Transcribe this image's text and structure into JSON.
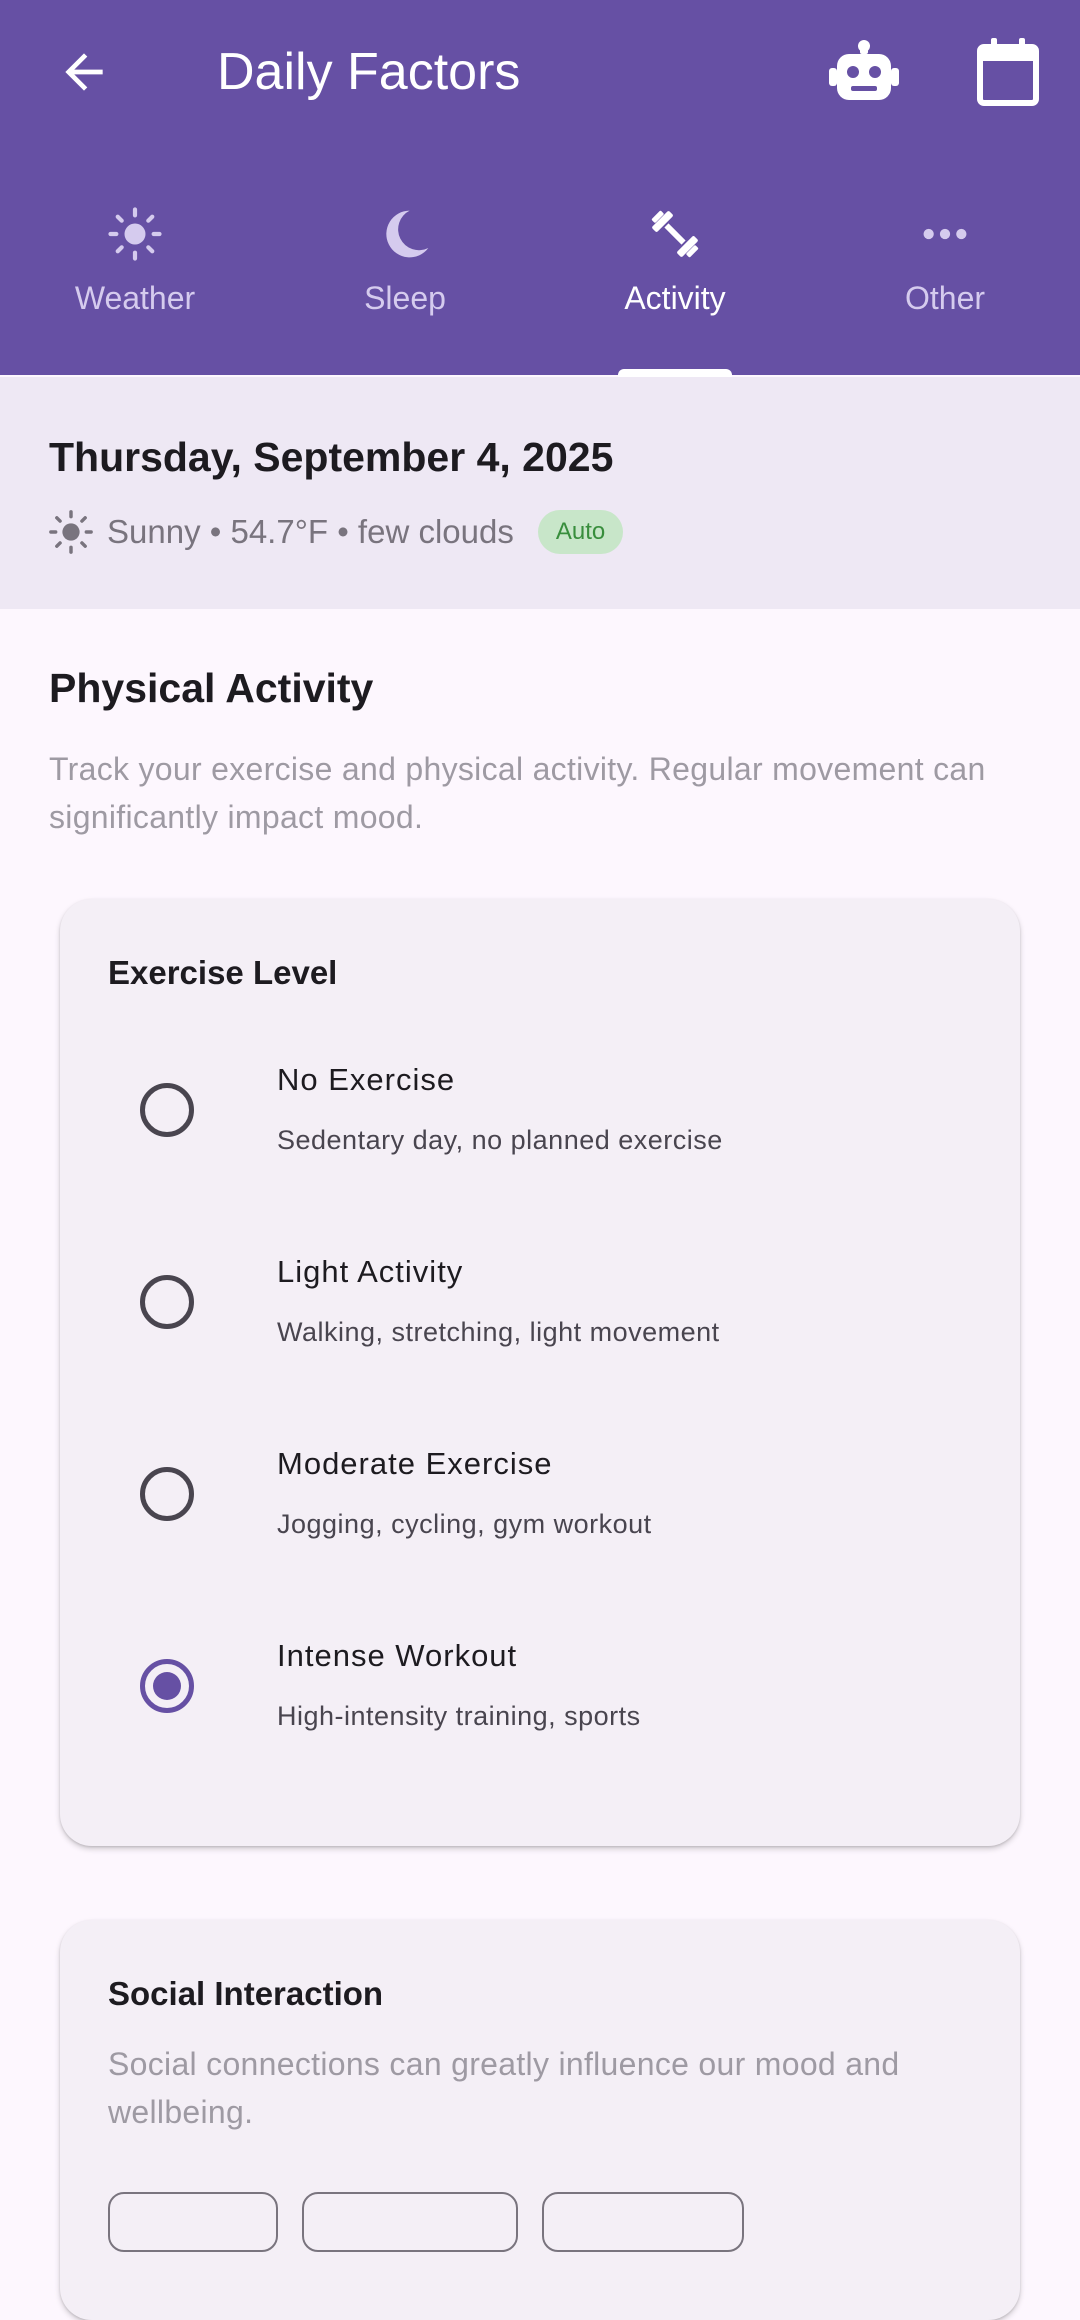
{
  "appbar": {
    "title": "Daily Factors",
    "back_icon": "arrow-back-icon",
    "assistant_icon": "robot-icon",
    "calendar_icon": "calendar-icon",
    "color": "#6650A4"
  },
  "tabs": [
    {
      "label": "Weather",
      "icon": "sun-icon",
      "active": false
    },
    {
      "label": "Sleep",
      "icon": "moon-icon",
      "active": false
    },
    {
      "label": "Activity",
      "icon": "dumbbell-icon",
      "active": true
    },
    {
      "label": "Other",
      "icon": "more-horiz-icon",
      "active": false
    }
  ],
  "date_header": {
    "date": "Thursday, September 4, 2025",
    "weather_summary": "Sunny • 54.7°F • few clouds",
    "badge": "Auto"
  },
  "section": {
    "title": "Physical Activity",
    "description": "Track your exercise and physical activity. Regular movement can significantly impact mood."
  },
  "exercise_card": {
    "title": "Exercise Level",
    "options": [
      {
        "title": "No Exercise",
        "subtitle": "Sedentary day, no planned exercise",
        "selected": false
      },
      {
        "title": "Light Activity",
        "subtitle": "Walking, stretching, light movement",
        "selected": false
      },
      {
        "title": "Moderate Exercise",
        "subtitle": "Jogging, cycling, gym workout",
        "selected": false
      },
      {
        "title": "Intense Workout",
        "subtitle": "High-intensity training, sports",
        "selected": true
      }
    ]
  },
  "social_card": {
    "title": "Social Interaction",
    "description": "Social connections can greatly influence our mood and wellbeing."
  }
}
